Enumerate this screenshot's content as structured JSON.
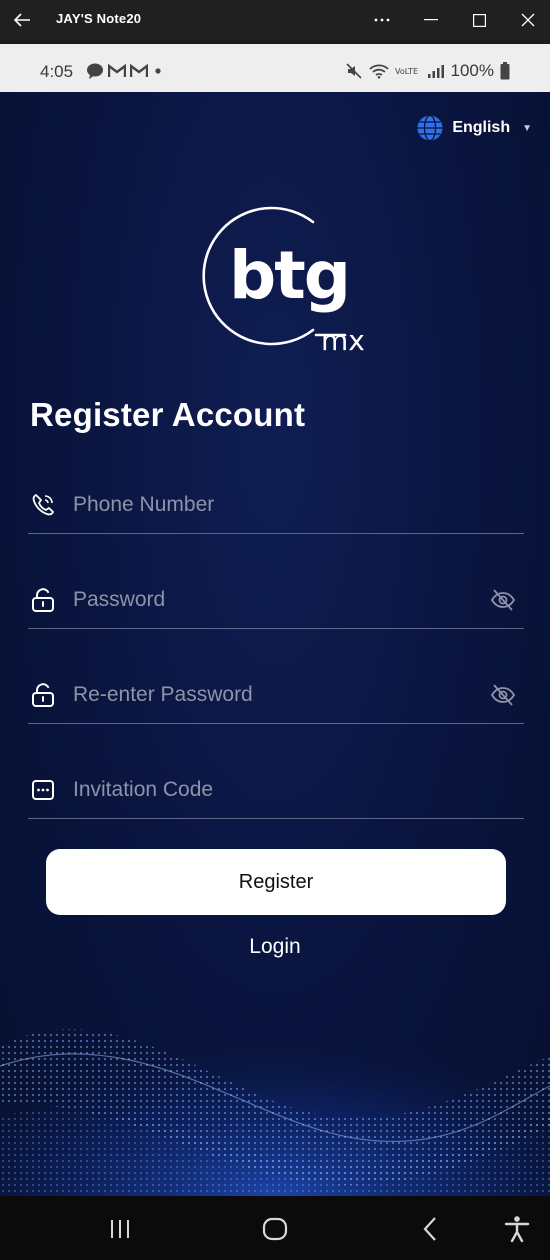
{
  "window": {
    "title": "JAY'S Note20",
    "controls": [
      "more-icon",
      "minimize-icon",
      "maximize-icon",
      "close-icon"
    ]
  },
  "status_bar": {
    "time": "4:05",
    "battery": "100%",
    "icons_left": [
      "talk-icon",
      "gmail-icon",
      "gmail-icon",
      "dot-icon"
    ],
    "icons_right": [
      "mute-icon",
      "wifi-icon",
      "volte-icon",
      "signal-icon",
      "battery-icon"
    ]
  },
  "language": {
    "label": "English",
    "icon": "globe-icon"
  },
  "logo": {
    "main": "btg",
    "sub": "mx"
  },
  "title": "Register Account",
  "form": {
    "phone_placeholder": "Phone Number",
    "password_placeholder": "Password",
    "reenter_placeholder": "Re-enter Password",
    "invitation_placeholder": "Invitation Code"
  },
  "actions": {
    "register_label": "Register",
    "login_label": "Login"
  },
  "nav": [
    "recents-icon",
    "home-icon",
    "back-icon",
    "accessibility-icon"
  ],
  "colors": {
    "background": "#0a1540",
    "accent": "#3d78ff",
    "button": "#ffffff"
  }
}
